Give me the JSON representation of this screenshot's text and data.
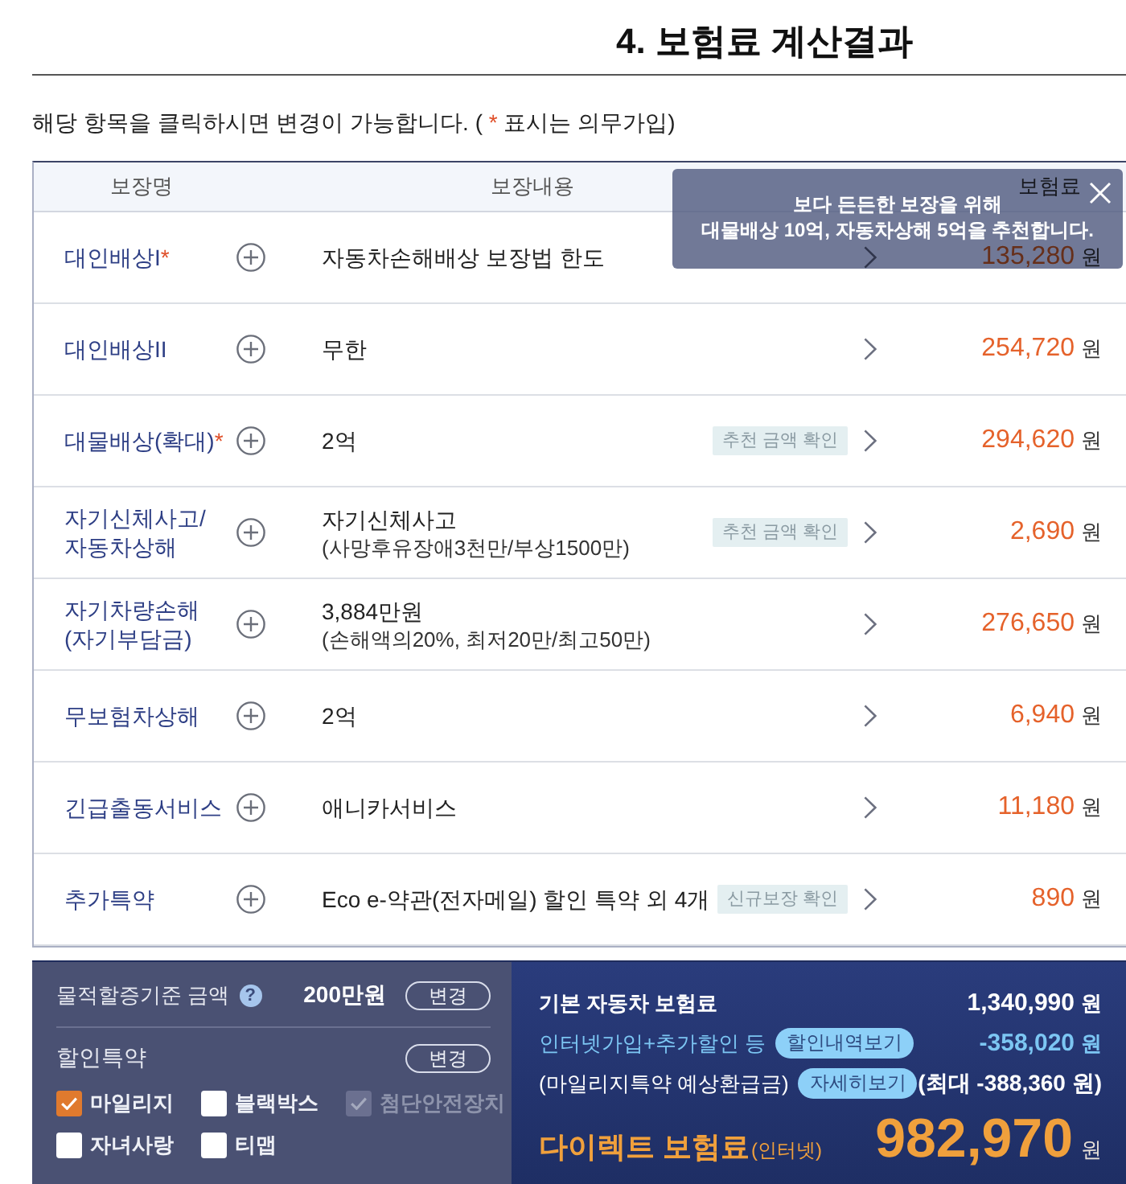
{
  "title": "4. 보험료 계산결과",
  "notice": {
    "before": "해당 항목을 클릭하시면 변경이 가능합니다. ( ",
    "mark": "*",
    "after": " 표시는 의무가입)"
  },
  "table": {
    "columns": [
      "보장명",
      "보장내용",
      "보험료"
    ],
    "rows": [
      {
        "name_lines": [
          "대인배상I"
        ],
        "required_mark": "*",
        "detail": "자동차손해배상 보장법 한도",
        "amount": "135,280",
        "unit": "원"
      },
      {
        "name_lines": [
          "대인배상II"
        ],
        "detail": "무한",
        "amount": "254,720",
        "unit": "원"
      },
      {
        "name_lines": [
          "대물배상(확대)"
        ],
        "required_mark": "*",
        "detail": "2억",
        "badge": "추천 금액 확인",
        "amount": "294,620",
        "unit": "원"
      },
      {
        "name_lines": [
          "자기신체사고/",
          "자동차상해"
        ],
        "detail": "자기신체사고",
        "detail_note": "(사망후유장애3천만/부상1500만)",
        "badge": "추천 금액 확인",
        "amount": "2,690",
        "unit": "원"
      },
      {
        "name_lines": [
          "자기차량손해",
          "(자기부담금)"
        ],
        "detail": "3,884만원",
        "detail_note": "(손해액의20%, 최저20만/최고50만)",
        "amount": "276,650",
        "unit": "원"
      },
      {
        "name_lines": [
          "무보험차상해"
        ],
        "detail": "2억",
        "amount": "6,940",
        "unit": "원"
      },
      {
        "name_lines": [
          "긴급출동서비스"
        ],
        "detail": "애니카서비스",
        "amount": "11,180",
        "unit": "원"
      },
      {
        "name_lines": [
          "추가특약"
        ],
        "detail": "Eco e-약관(전자메일) 할인 특약 외 4개",
        "badge": "신규보장 확인",
        "amount": "890",
        "unit": "원"
      }
    ]
  },
  "tooltip": {
    "lines": [
      "보다 든든한 보장을 위해",
      "대물배상 10억, 자동차상해 5억을 추천합니다."
    ]
  },
  "property_damage": {
    "label": "물적할증기준 금액",
    "help": "?",
    "value": "200만원",
    "button": "변경"
  },
  "discounts": {
    "label": "할인특약",
    "button": "변경",
    "options": [
      {
        "label": "마일리지",
        "checked": true,
        "disabled": false
      },
      {
        "label": "블랙박스",
        "checked": false,
        "disabled": false
      },
      {
        "label": "첨단안전장치",
        "checked": true,
        "disabled": true
      },
      {
        "label": "자녀사랑",
        "checked": false,
        "disabled": false
      },
      {
        "label": "티맵",
        "checked": false,
        "disabled": false
      }
    ]
  },
  "summary": {
    "base": {
      "label": "기본 자동차 보험료",
      "amount": "1,340,990",
      "unit": "원"
    },
    "discount": {
      "label": "인터넷가입+추가할인 등",
      "button": "할인내역보기",
      "amount": "-358,020",
      "unit": "원"
    },
    "refund": {
      "label": "(마일리지특약 예상환급금)",
      "button": "자세히보기",
      "amount": "(최대 -388,360 원)"
    },
    "total": {
      "label": "다이렉트 보험료",
      "suffix": "(인터넷)",
      "amount": "982,970",
      "unit": "원"
    }
  }
}
